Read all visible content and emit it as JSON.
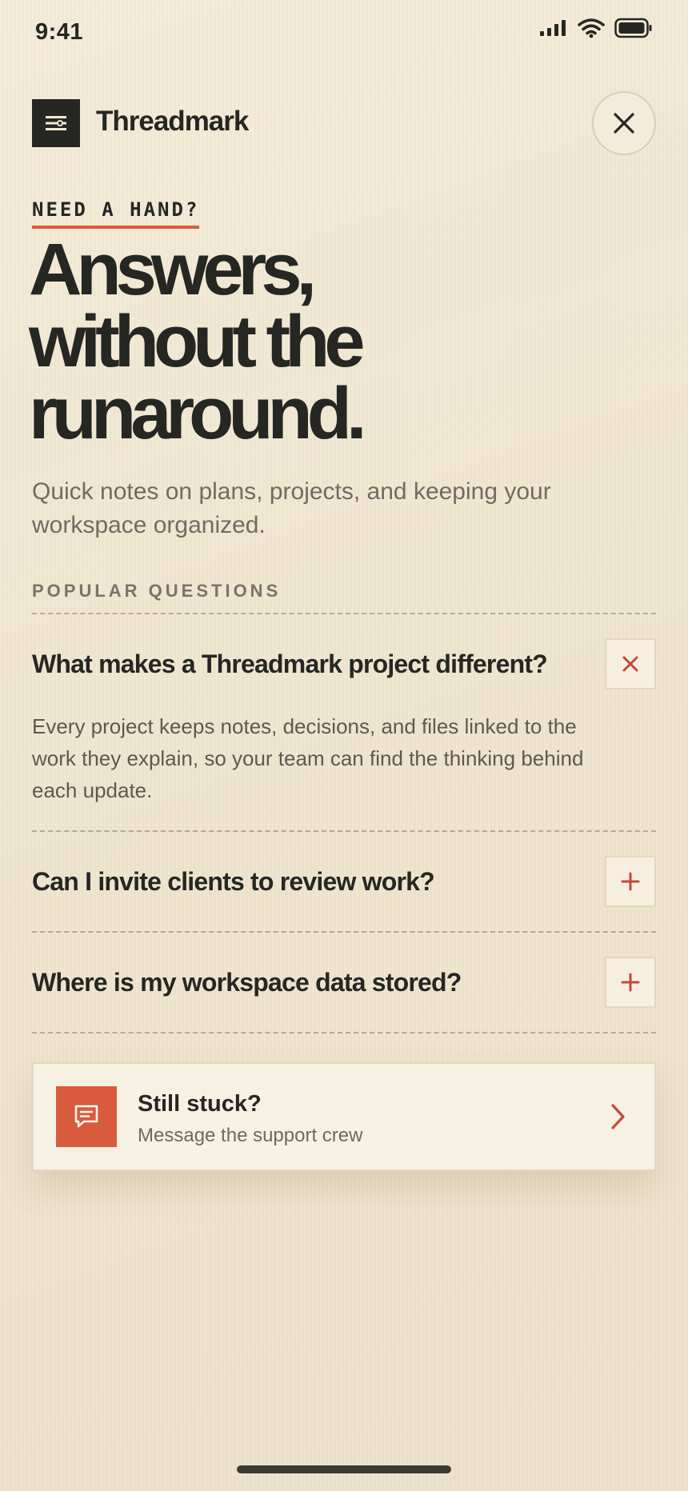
{
  "status_bar": {
    "time": "9:41",
    "icons": [
      "signal-icon",
      "wifi-icon",
      "battery-icon"
    ]
  },
  "header": {
    "brand_name": "Threadmark",
    "menu_icon": "menu-icon",
    "close_icon": "close-icon"
  },
  "hero": {
    "eyebrow": "NEED A HAND?",
    "title_line_1": "Answers,",
    "title_line_2": "without the",
    "title_line_3": "runaround.",
    "subtitle": "Quick notes on plans, projects, and keeping your workspace organized."
  },
  "faq": {
    "section_label": "POPULAR QUESTIONS",
    "items": [
      {
        "question": "What makes a Threadmark project different?",
        "answer": "Every project keeps notes, decisions, and files linked to the work they explain, so your team can find the thinking behind each update.",
        "expanded": true,
        "toggle_icon": "close-icon"
      },
      {
        "question": "Can I invite clients to review work?",
        "expanded": false,
        "toggle_icon": "plus-icon"
      },
      {
        "question": "Where is my workspace data stored?",
        "expanded": false,
        "toggle_icon": "plus-icon"
      }
    ]
  },
  "support": {
    "title": "Still stuck?",
    "subtitle": "Message the support crew",
    "icon": "chat-bubble-icon",
    "chevron_icon": "chevron-right-icon"
  },
  "colors": {
    "background": "#f1e8d4",
    "ink": "#262623",
    "accent": "#d95b3e",
    "muted_text": "#716b61"
  }
}
